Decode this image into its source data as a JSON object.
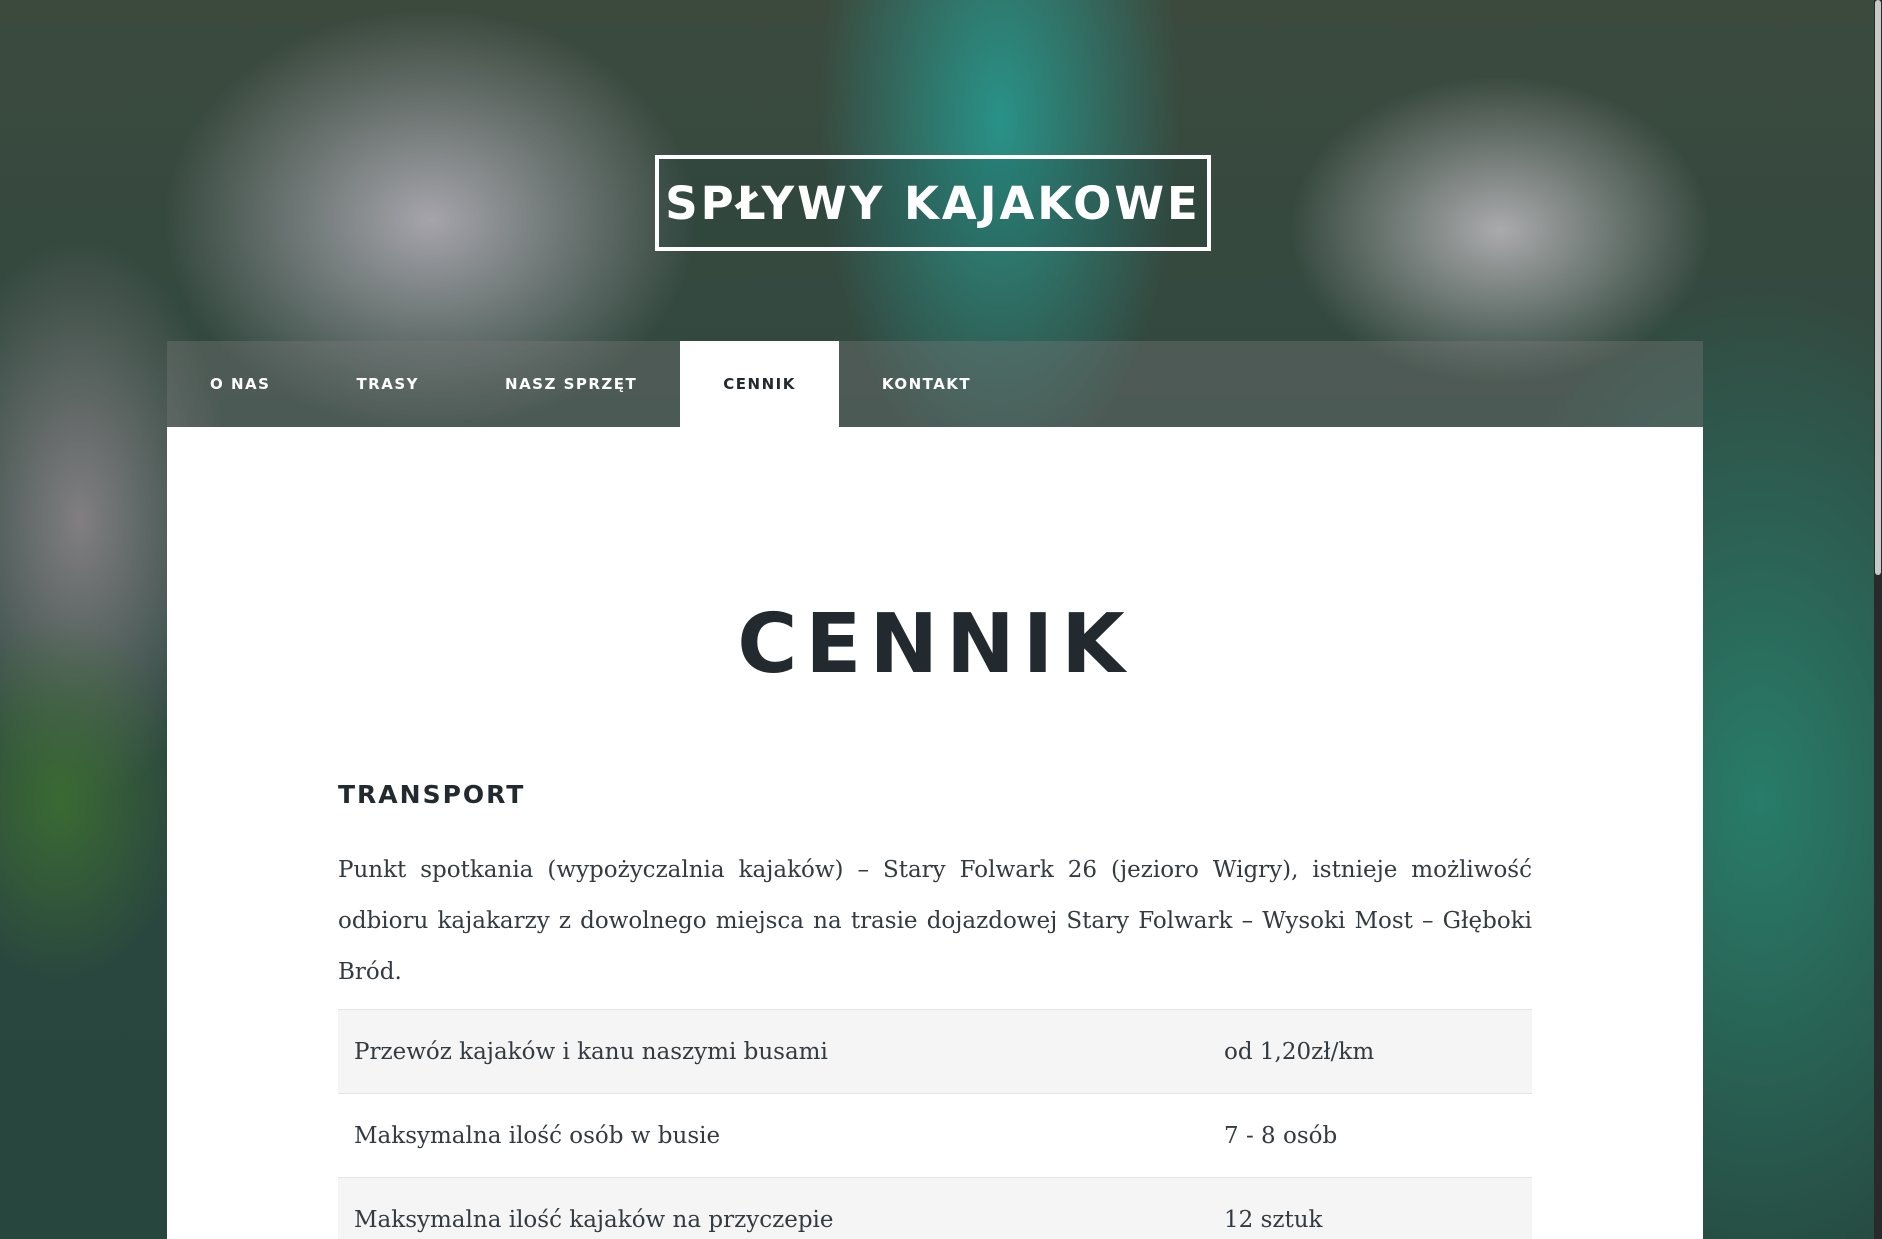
{
  "site": {
    "title": "SPŁYWY KAJAKOWE"
  },
  "nav": {
    "items": [
      {
        "label": "O NAS",
        "active": false
      },
      {
        "label": "TRASY",
        "active": false
      },
      {
        "label": "NASZ SPRZĘT",
        "active": false
      },
      {
        "label": "CENNIK",
        "active": true
      },
      {
        "label": "KONTAKT",
        "active": false
      }
    ]
  },
  "main": {
    "page_title": "CENNIK",
    "section_title": "TRANSPORT",
    "intro": "Punkt spotkania (wypożyczalnia kajaków) – Stary Folwark 26 (jezioro Wigry), istnieje możliwość odbioru kajakarzy z dowolnego miejsca na trasie dojazdowej Stary Folwark – Wysoki Most – Głęboki Bród.",
    "table": [
      {
        "label": "Przewóz kajaków i kanu naszymi busami",
        "value": "od 1,20zł/km"
      },
      {
        "label": "Maksymalna ilość osób w busie",
        "value": "7 - 8 osób"
      },
      {
        "label": "Maksymalna ilość kajaków na przyczepie",
        "value": "12 sztuk"
      }
    ]
  },
  "colors": {
    "text_dark": "#222a30",
    "nav_bar": "#787878",
    "card_bg": "#ffffff",
    "row_stripe": "#f5f5f5"
  }
}
